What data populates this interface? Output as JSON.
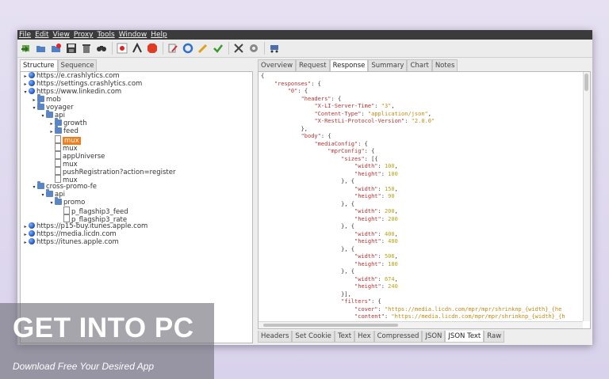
{
  "menu": [
    "File",
    "Edit",
    "View",
    "Proxy",
    "Tools",
    "Window",
    "Help"
  ],
  "toolbar_icons": [
    "import-icon",
    "open-icon",
    "open-recent-icon",
    "save-icon",
    "clear-icon",
    "find-icon",
    "record-icon",
    "throttle-icon",
    "breakpoint-icon",
    "edit-icon",
    "repeat-icon",
    "pencil-icon",
    "validate-icon",
    "tools-icon",
    "settings-icon",
    "shopping-cart-icon"
  ],
  "left_tabs": [
    {
      "label": "Structure",
      "active": true
    },
    {
      "label": "Sequence",
      "active": false
    }
  ],
  "tree": [
    {
      "indent": 0,
      "toggle": "▸",
      "icon": "globe",
      "label": "https://e.crashlytics.com"
    },
    {
      "indent": 0,
      "toggle": "▸",
      "icon": "globe",
      "label": "https://settings.crashlytics.com"
    },
    {
      "indent": 0,
      "toggle": "▾",
      "icon": "globe",
      "label": "https://www.linkedin.com"
    },
    {
      "indent": 1,
      "toggle": "▸",
      "icon": "folder",
      "label": "mob"
    },
    {
      "indent": 1,
      "toggle": "▾",
      "icon": "folder",
      "label": "voyager"
    },
    {
      "indent": 2,
      "toggle": "▾",
      "icon": "folder",
      "label": "api"
    },
    {
      "indent": 3,
      "toggle": "▸",
      "icon": "folder",
      "label": "growth"
    },
    {
      "indent": 3,
      "toggle": "▸",
      "icon": "folder",
      "label": "feed"
    },
    {
      "indent": 3,
      "toggle": "",
      "icon": "file",
      "label": "mux",
      "selected": true
    },
    {
      "indent": 3,
      "toggle": "",
      "icon": "file",
      "label": "mux"
    },
    {
      "indent": 3,
      "toggle": "",
      "icon": "file",
      "label": "appUniverse"
    },
    {
      "indent": 3,
      "toggle": "",
      "icon": "file",
      "label": "mux"
    },
    {
      "indent": 3,
      "toggle": "",
      "icon": "file",
      "label": "pushRegistration?action=register"
    },
    {
      "indent": 3,
      "toggle": "",
      "icon": "file",
      "label": "mux"
    },
    {
      "indent": 1,
      "toggle": "▾",
      "icon": "folder",
      "label": "cross-promo-fe"
    },
    {
      "indent": 2,
      "toggle": "▾",
      "icon": "folder",
      "label": "api"
    },
    {
      "indent": 3,
      "toggle": "▾",
      "icon": "folder",
      "label": "promo"
    },
    {
      "indent": 4,
      "toggle": "",
      "icon": "file",
      "label": "p_flagship3_feed"
    },
    {
      "indent": 4,
      "toggle": "",
      "icon": "file",
      "label": "p_flagship3_rate"
    },
    {
      "indent": 0,
      "toggle": "▸",
      "icon": "globe",
      "label": "https://p15-buy.itunes.apple.com"
    },
    {
      "indent": 0,
      "toggle": "▸",
      "icon": "globe",
      "label": "https://media.licdn.com"
    },
    {
      "indent": 0,
      "toggle": "▸",
      "icon": "globe",
      "label": "https://itunes.apple.com"
    }
  ],
  "right_tabs": [
    {
      "label": "Overview",
      "active": false
    },
    {
      "label": "Request",
      "active": false
    },
    {
      "label": "Response",
      "active": true
    },
    {
      "label": "Summary",
      "active": false
    },
    {
      "label": "Chart",
      "active": false
    },
    {
      "label": "Notes",
      "active": false
    }
  ],
  "json_lines": [
    "{",
    "    \"responses\": {",
    "        \"0\": {",
    "            \"headers\": {",
    "                \"X-LI-Server-Time\": \"3\",",
    "                \"Content-Type\": \"application/json\",",
    "                \"X-RestLi-Protocol-Version\": \"2.0.0\"",
    "            },",
    "            \"body\": {",
    "                \"mediaConfig\": {",
    "                    \"mprConfig\": {",
    "                        \"sizes\": [{",
    "                            \"width\": 100,",
    "                            \"height\": 100",
    "                        }, {",
    "                            \"width\": 150,",
    "                            \"height\": 90",
    "                        }, {",
    "                            \"width\": 200,",
    "                            \"height\": 200",
    "                        }, {",
    "                            \"width\": 400,",
    "                            \"height\": 400",
    "                        }, {",
    "                            \"width\": 506,",
    "                            \"height\": 180",
    "                        }, {",
    "                            \"width\": 674,",
    "                            \"height\": 240",
    "                        }],",
    "                        \"filters\": {",
    "                            \"cover\": \"https://media.licdn.com/mpr/mpr/shrinknp_{width}_{he",
    "                            \"content\": \"https://media.licdn.com/mpr/mpr/shrinknp_{width}_{h"
  ],
  "bottom_tabs": [
    {
      "label": "Headers",
      "active": false
    },
    {
      "label": "Set Cookie",
      "active": false
    },
    {
      "label": "Text",
      "active": false
    },
    {
      "label": "Hex",
      "active": false
    },
    {
      "label": "Compressed",
      "active": false
    },
    {
      "label": "JSON",
      "active": false
    },
    {
      "label": "JSON Text",
      "active": true
    },
    {
      "label": "Raw",
      "active": false
    }
  ],
  "watermark": {
    "title": "GET INTO PC",
    "subtitle": "Download Free Your Desired App"
  }
}
